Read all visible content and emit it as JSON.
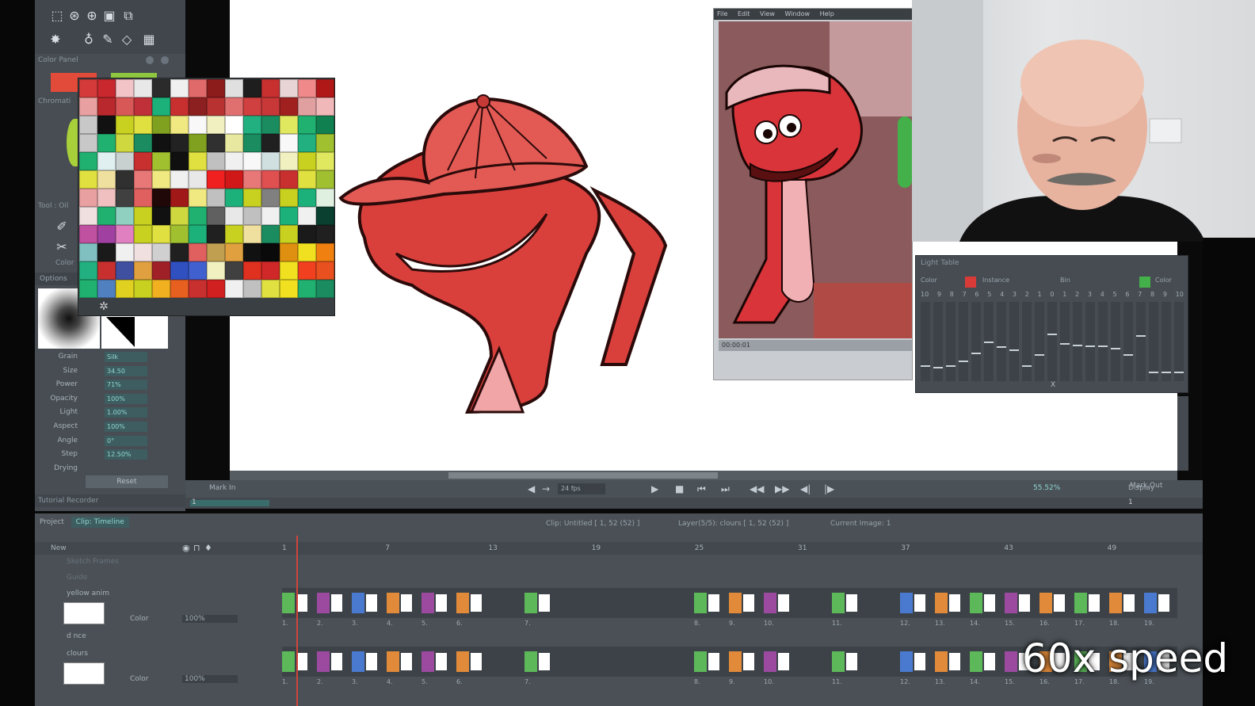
{
  "panels": {
    "color_panel": "Color Panel",
    "chromatic": "Chromati",
    "tool": "Tool : Oil",
    "color_tab": "Color",
    "options": "Options",
    "tutorial_recorder": "Tutorial Recorder"
  },
  "brush_props": [
    {
      "label": "Grain",
      "value": "Silk"
    },
    {
      "label": "Size",
      "value": "34.50"
    },
    {
      "label": "Power",
      "value": "71%"
    },
    {
      "label": "Opacity",
      "value": "100%"
    },
    {
      "label": "Light",
      "value": "1.00%"
    },
    {
      "label": "Aspect",
      "value": "100%"
    },
    {
      "label": "Angle",
      "value": "0°"
    },
    {
      "label": "Step",
      "value": "12.50%"
    },
    {
      "label": "Drying",
      "value": ""
    }
  ],
  "reset_label": "Reset",
  "ref_menu": [
    "File",
    "Edit",
    "View",
    "Window",
    "Help"
  ],
  "ref_time": "00:00:01",
  "light_table": {
    "title": "Light Table",
    "left": "Color",
    "mode": "Instance",
    "blend": "Bin",
    "right": "Color",
    "nums": [
      "10",
      "9",
      "8",
      "7",
      "6",
      "5",
      "4",
      "3",
      "2",
      "1",
      "0",
      "1",
      "2",
      "3",
      "4",
      "5",
      "6",
      "7",
      "8",
      "9",
      "10"
    ],
    "levels": [
      0.8,
      0.82,
      0.8,
      0.74,
      0.64,
      0.5,
      0.56,
      0.6,
      0.8,
      0.66,
      0.4,
      0.52,
      0.54,
      0.55,
      0.55,
      0.58,
      0.66,
      0.42,
      0.88,
      0.88,
      0.88
    ],
    "center_label": "X"
  },
  "playback": {
    "mark_in": "Mark In",
    "fps": "24 fps",
    "zoom": "55.52%",
    "display": "Display",
    "mark_out": "Mark Out",
    "start": "1",
    "end": "1"
  },
  "timeline": {
    "tabs": [
      "Project",
      "Clip: Timeline"
    ],
    "clip_status": "Clip: Untitled [ 1, 52 (52) ]",
    "layer_status": "Layer(5/5): clours [ 1, 52 (52) ]",
    "current_image": "Current Image: 1",
    "new_label": "New",
    "ruler": [
      "1",
      "7",
      "13",
      "19",
      "25",
      "31",
      "37",
      "43",
      "49"
    ],
    "layers": [
      {
        "name": "Sketch Frames"
      },
      {
        "name": "Guide"
      },
      {
        "name": "yellow anim",
        "color_label": "Color",
        "opacity": "100%"
      },
      {
        "name": "d nce"
      },
      {
        "name": "clours",
        "color_label": "Color",
        "opacity": "100%"
      }
    ],
    "cel_labels": [
      "1.",
      "2.",
      "3.",
      "4.",
      "5.",
      "6.",
      "7.",
      "8.",
      "9.",
      "10.",
      "11.",
      "12.",
      "13.",
      "14.",
      "15.",
      "16.",
      "17.",
      "18.",
      "19."
    ]
  },
  "caption": "60x speed",
  "colors": {
    "accent": "#3d5d60",
    "playhead": "#d0453a",
    "cel_green": "#5db85a",
    "cel_purple": "#9b4aa0",
    "cel_blue": "#4a7ad0",
    "cel_orange": "#e08a3a"
  },
  "icons": [
    "selection-icon",
    "transform-icon",
    "zoom-icon",
    "hand-icon",
    "brush-icon",
    "eraser-icon",
    "fill-icon",
    "eyedropper-icon",
    "play-icon",
    "stop-icon",
    "first-frame-icon",
    "last-frame-icon",
    "prev-frame-icon",
    "next-frame-icon",
    "loop-icon",
    "eye-icon",
    "lock-icon",
    "light-table-icon"
  ]
}
